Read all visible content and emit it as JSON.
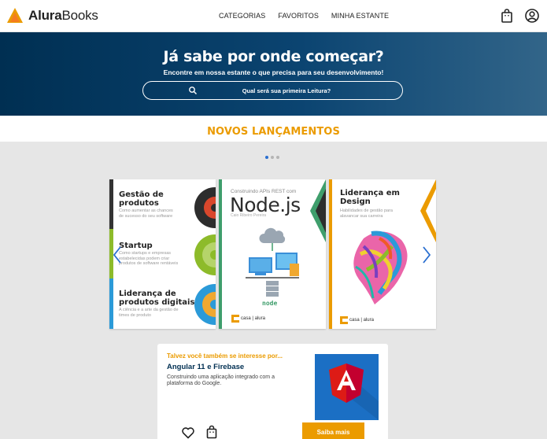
{
  "header": {
    "logo_prefix": "Alura",
    "logo_suffix": "Books",
    "nav": [
      "CATEGORIAS",
      "FAVORITOS",
      "MINHA ESTANTE"
    ],
    "icons": [
      "shopping-bag-icon",
      "user-icon"
    ]
  },
  "banner": {
    "title": "Já sabe por onde começar?",
    "subtitle": "Encontre em nossa estante o que precisa para seu desenvolvimento!",
    "search_placeholder": "Qual será sua primeira Leitura?"
  },
  "releases": {
    "title": "NOVOS LANÇAMENTOS",
    "dots": 3,
    "active_dot": 0,
    "books": [
      {
        "sections": [
          {
            "title": "Gestão de\nprodutos",
            "subtitle": "Como aumentar as chances\nde sucesso do seu software"
          },
          {
            "title": "Startup",
            "subtitle": "Como startups e empresas\nestabelecidas podem criar\nprodutos de software rentáveis"
          },
          {
            "title": "Liderança de\nprodutos digitais",
            "subtitle": "A ciência e a arte da gestão de\ntimes de produto"
          }
        ],
        "colors": [
          "#333333",
          "#8dbb2a",
          "#2b9ad8"
        ]
      },
      {
        "kicker": "Construindo APIs REST com",
        "title": "Node.js",
        "author": "Caio Ribeiro Pereira",
        "logo": "node",
        "publisher": "casa | alura",
        "accent": "#3f9e6c"
      },
      {
        "title": "Liderança em\nDesign",
        "subtitle": "Habilidades de gestão para\nalavancar sua carreira",
        "publisher": "casa | alura",
        "accent": "#eb9b00"
      }
    ]
  },
  "recommend": {
    "kicker": "Talvez você também se interesse por...",
    "title": "Angular 11 e Firebase",
    "description": "Construindo uma aplicação integrado com a plataforma do Google.",
    "button": "Saiba mais",
    "icons": [
      "heart-icon",
      "shopping-bag-icon"
    ]
  },
  "colors": {
    "brand_orange": "#eb9b00",
    "navy": "#002f52"
  }
}
